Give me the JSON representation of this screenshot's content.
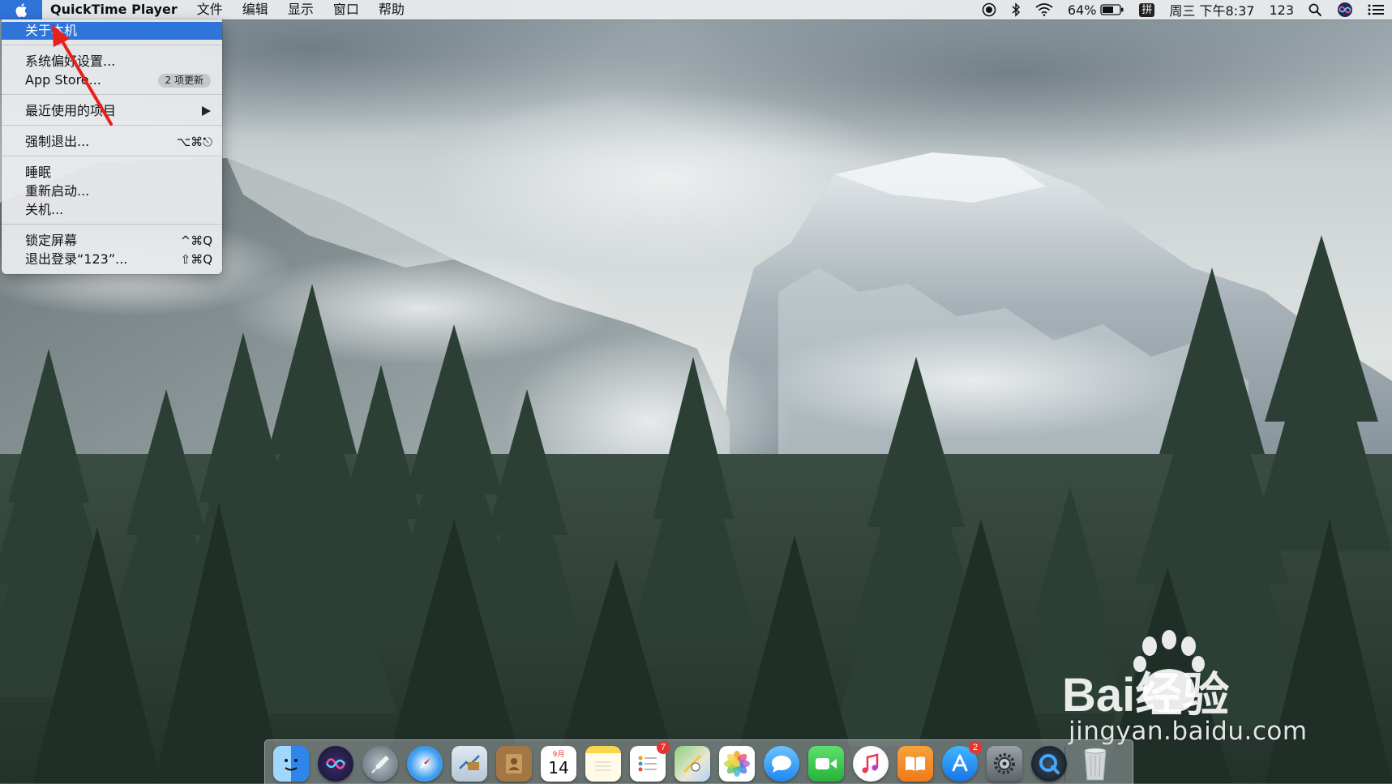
{
  "menubar": {
    "app_name": "QuickTime Player",
    "menus": [
      "文件",
      "编辑",
      "显示",
      "窗口",
      "帮助"
    ],
    "battery": "64%",
    "input_method": "拼",
    "clock": "周三 下午8:37",
    "user": "123"
  },
  "apple_menu": {
    "about": "关于本机",
    "preferences": "系统偏好设置...",
    "app_store": "App Store...",
    "app_store_badge": "2 项更新",
    "recent": "最近使用的项目",
    "force_quit": "强制退出...",
    "force_quit_shortcut": "⌥⌘⎋",
    "sleep": "睡眠",
    "restart": "重新启动...",
    "shutdown": "关机...",
    "lock": "锁定屏幕",
    "lock_shortcut": "^⌘Q",
    "logout": "退出登录“123”...",
    "logout_shortcut": "⇧⌘Q"
  },
  "dock": {
    "calendar_month": "9月",
    "calendar_day": "14",
    "reminders_badge": "7",
    "appstore_badge": "2",
    "items": [
      "finder-icon",
      "siri-icon",
      "launchpad-icon",
      "safari-icon",
      "mail-icon",
      "contacts-icon",
      "calendar-icon",
      "notes-icon",
      "reminders-icon",
      "maps-icon",
      "photos-icon",
      "messages-icon",
      "facetime-icon",
      "itunes-icon",
      "books-icon",
      "appstore-icon",
      "system-preferences-icon",
      "quicktime-icon",
      "trash-icon"
    ]
  },
  "watermark": {
    "logo": "Bai经验",
    "url": "jingyan.baidu.com"
  },
  "colors": {
    "highlight": "#2f74d8",
    "annotation_arrow": "#e8201c"
  }
}
